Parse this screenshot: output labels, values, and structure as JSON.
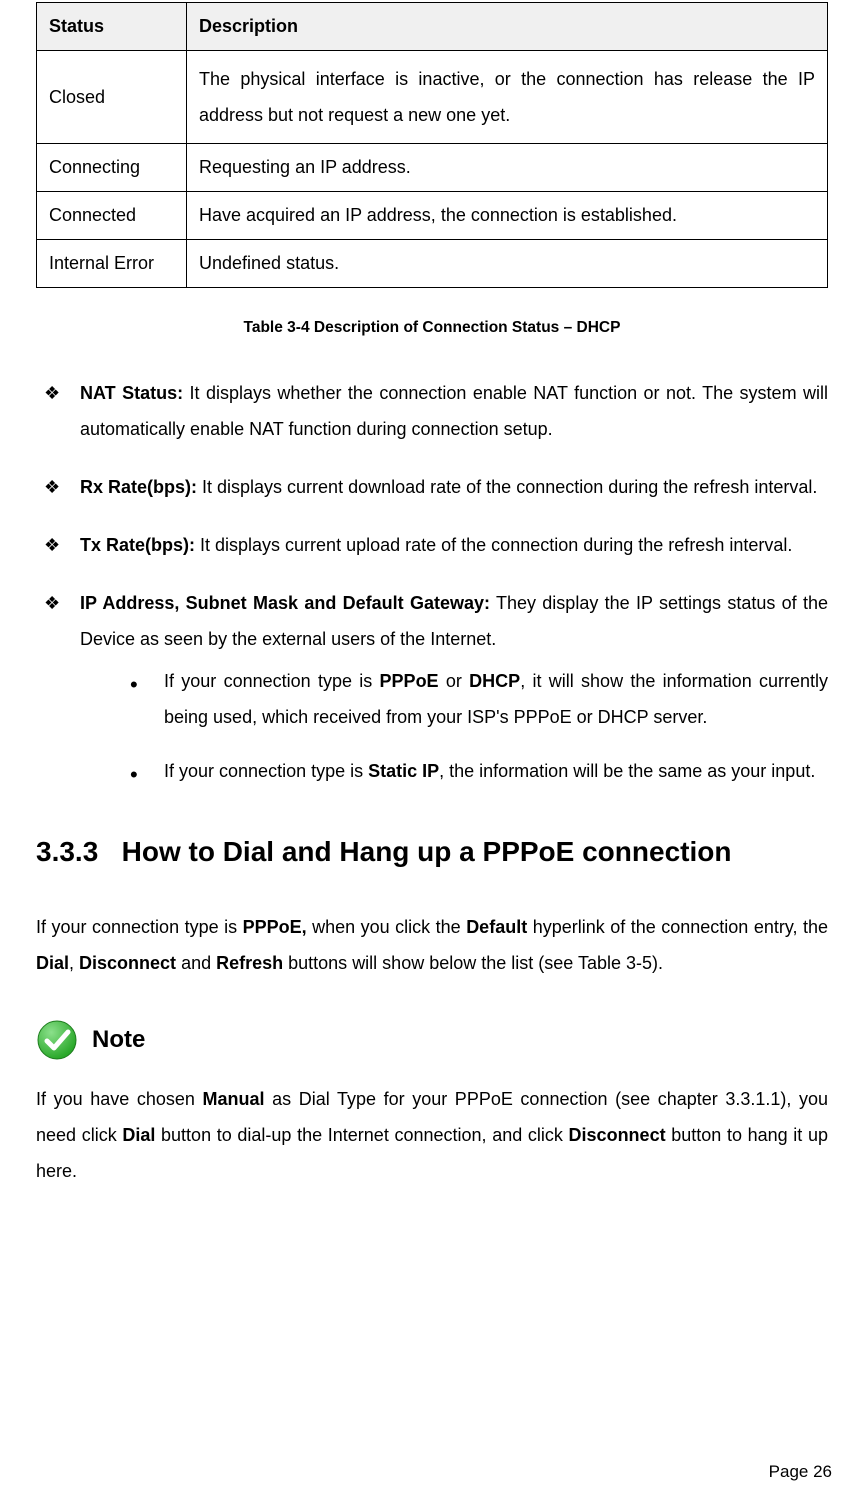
{
  "table": {
    "headers": {
      "status": "Status",
      "description": "Description"
    },
    "rows": [
      {
        "status": "Closed",
        "description": "The physical interface is inactive, or the connection has release the IP address but not request a new one yet."
      },
      {
        "status": "Connecting",
        "description": "Requesting an IP address."
      },
      {
        "status": "Connected",
        "description": "Have acquired an IP address, the connection is established."
      },
      {
        "status": "Internal Error",
        "description": "Undefined status."
      }
    ],
    "caption": "Table 3-4 Description of Connection Status – DHCP"
  },
  "definitions": {
    "nat_status": {
      "label": "NAT Status:",
      "text": " It displays whether the connection enable NAT function or not. The system will automatically enable NAT function during connection setup."
    },
    "rx_rate": {
      "label": "Rx Rate(bps):",
      "text": " It displays current download rate of the connection during the refresh interval."
    },
    "tx_rate": {
      "label": "Tx Rate(bps):",
      "text": " It displays current upload rate of the connection during the refresh interval."
    },
    "ip_settings": {
      "label": "IP Address, Subnet Mask and Default Gateway:",
      "text": " They display the IP settings status of the Device as seen by the external users of the Internet."
    }
  },
  "sub_bullets": {
    "b1": {
      "pre": "If your connection type is ",
      "bold1": "PPPoE",
      "mid": " or ",
      "bold2": "DHCP",
      "post": ", it will show the information currently being used, which received from your ISP's PPPoE or DHCP server."
    },
    "b2": {
      "pre": "If your connection type is ",
      "bold1": "Static IP",
      "post": ", the information will be the same as your input."
    }
  },
  "section": {
    "number": "3.3.3",
    "title": "How to Dial and Hang up a PPPoE connection"
  },
  "intro": {
    "p1": "If your connection type is ",
    "b1": "PPPoE,",
    "p2": " when you click the ",
    "b2": "Default",
    "p3": " hyperlink of the connection entry, the ",
    "b3": "Dial",
    "p4": ", ",
    "b4": "Disconnect",
    "p5": " and ",
    "b5": "Refresh",
    "p6": " buttons will show below the list (see Table 3-5)."
  },
  "note": {
    "label": "Note",
    "t1": "If you have chosen ",
    "b1": "Manual",
    "t2": " as Dial Type for your PPPoE connection (see chapter 3.3.1.1), you need click ",
    "b2": "Dial",
    "t3": " button to dial-up the Internet connection, and click ",
    "b3": "Disconnect",
    "t4": " button to hang it up here."
  },
  "page_number": "Page 26"
}
